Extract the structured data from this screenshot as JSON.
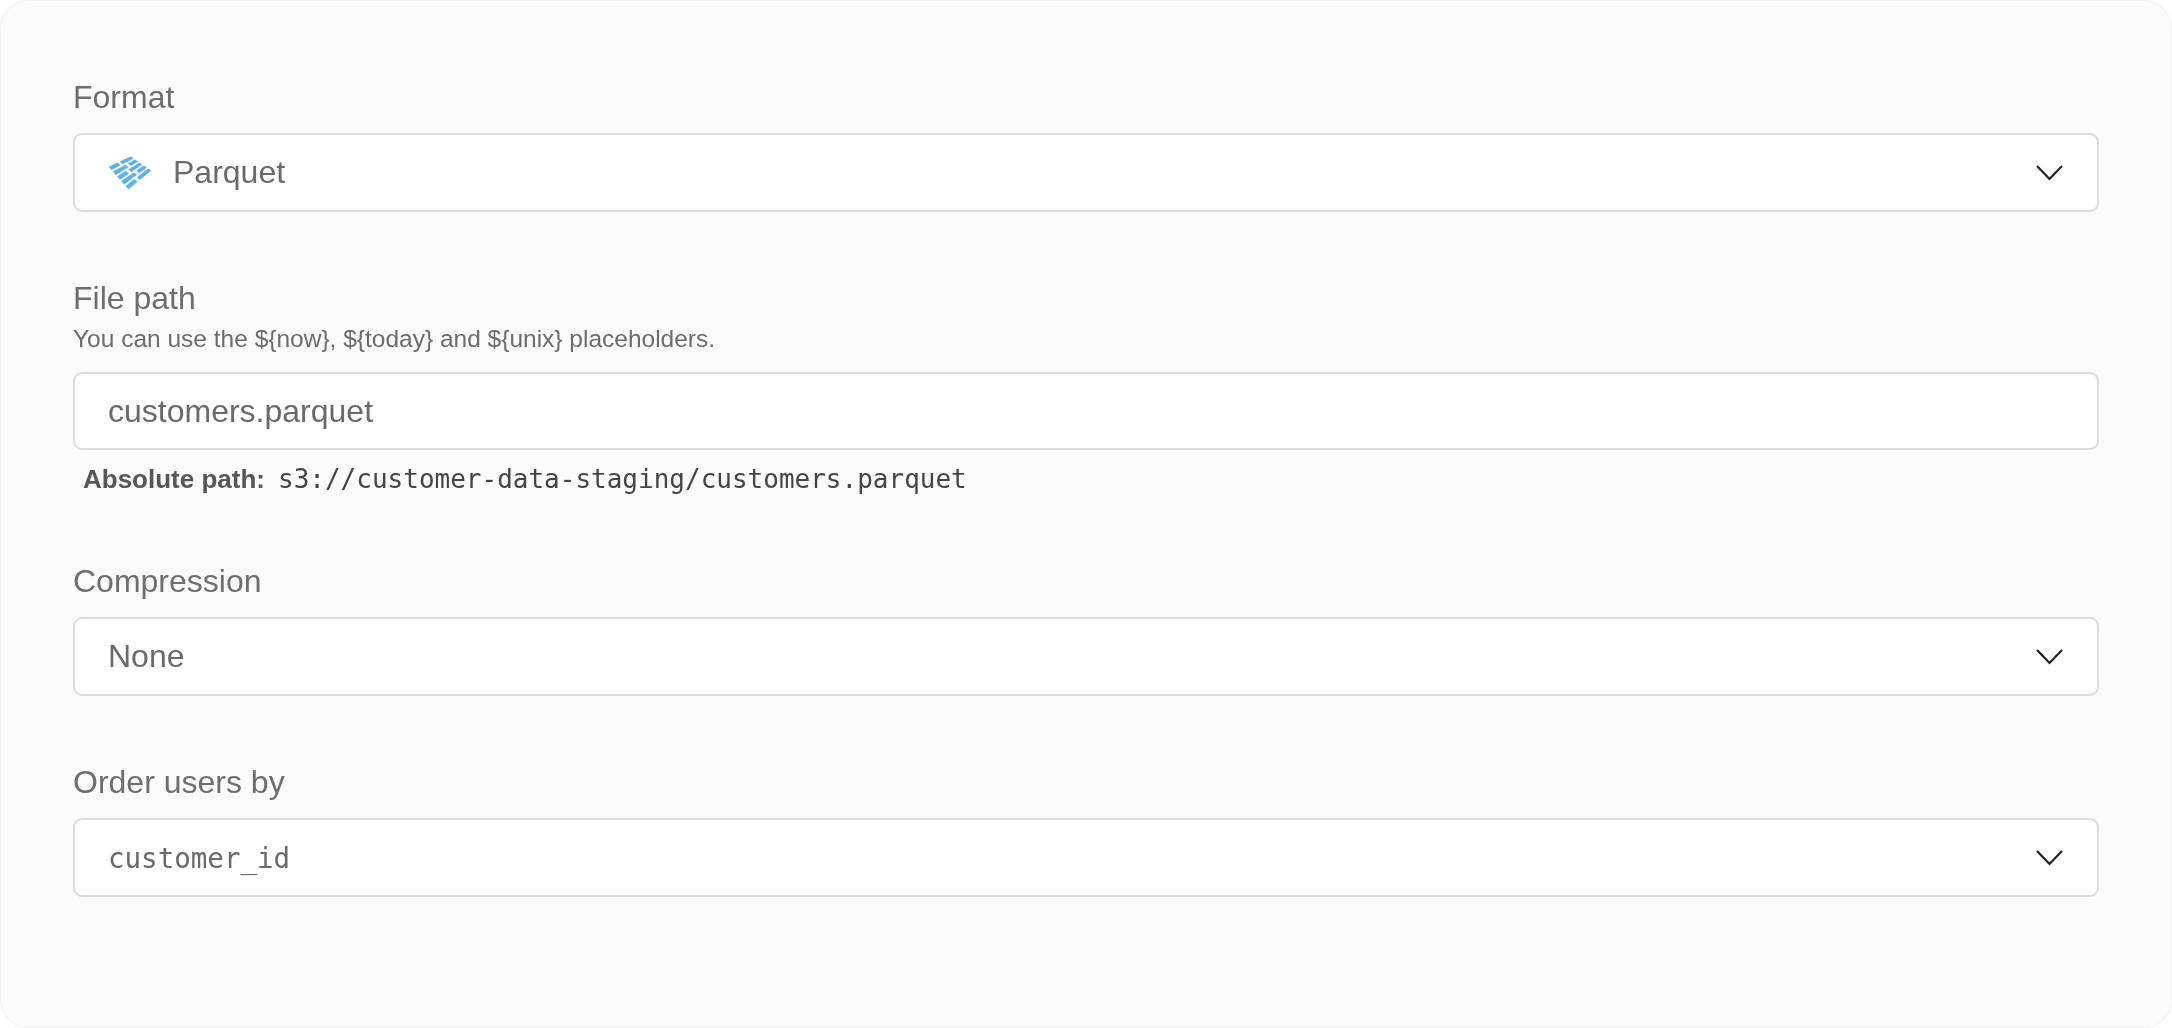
{
  "fields": [
    {
      "kind": "select",
      "label": "Format",
      "value": "Parquet",
      "icon": true
    },
    {
      "kind": "text",
      "label": "File path",
      "help": "You can use the ${now}, ${today} and ${unix} placeholders.",
      "value": "customers.parquet",
      "resolved": {
        "label": "Absolute path:",
        "value": "s3://customer-data-staging/customers.parquet"
      }
    },
    {
      "kind": "select",
      "label": "Compression",
      "value": "None",
      "icon": false
    },
    {
      "kind": "column-select",
      "label": "Order users by",
      "value": "customer_id",
      "icon": false
    }
  ]
}
